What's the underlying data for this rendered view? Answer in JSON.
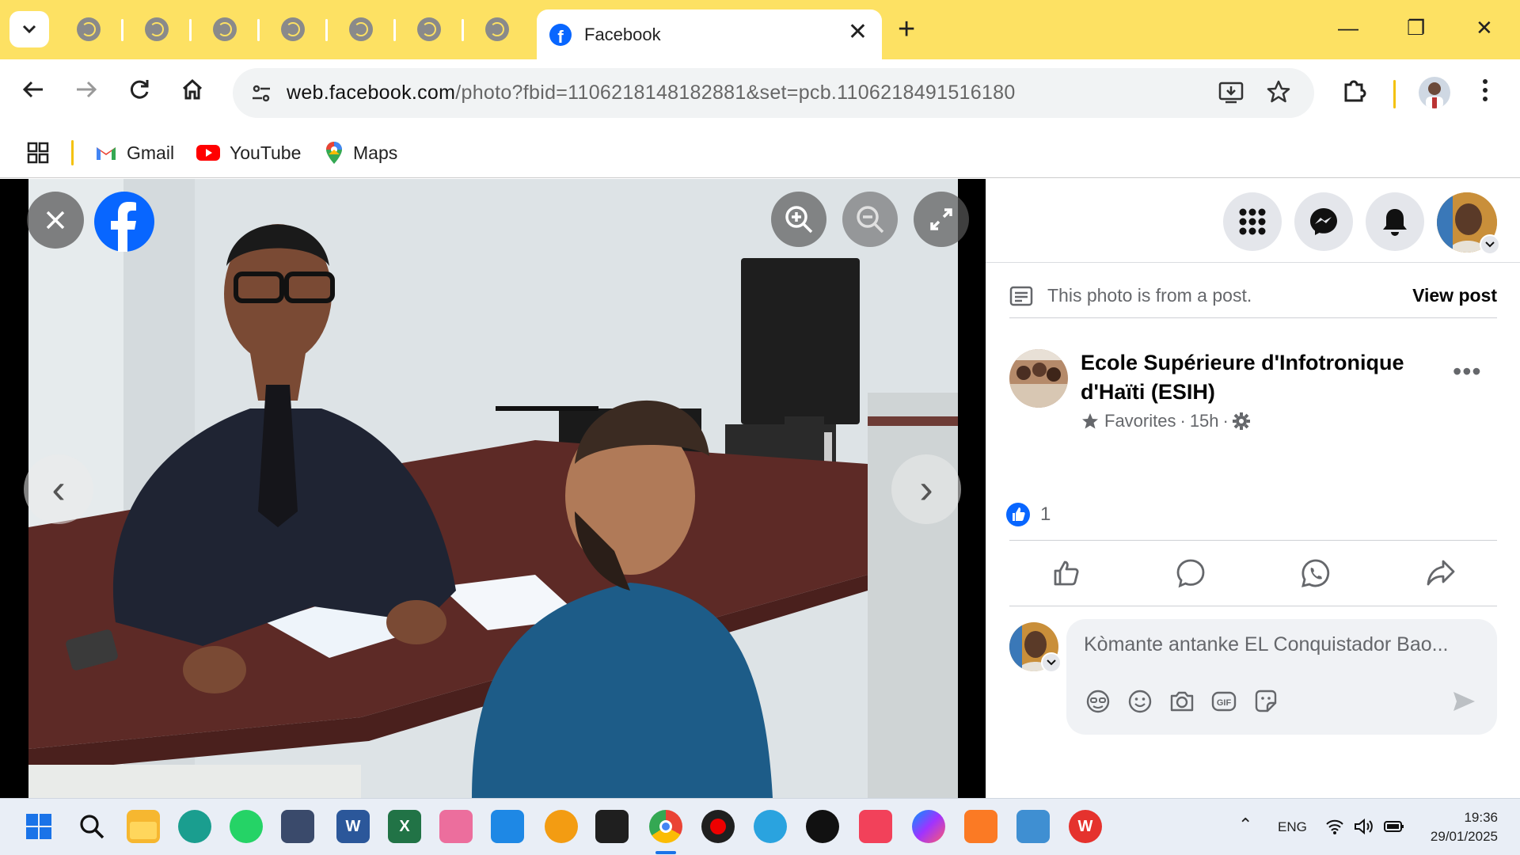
{
  "browser": {
    "active_tab": {
      "title": "Facebook"
    },
    "new_tab_symbol": "+",
    "close_symbol": "✕",
    "window_controls": {
      "minimize": "—",
      "restore": "❐",
      "close": "✕"
    },
    "url": {
      "host": "web.facebook.com",
      "path": "/photo?fbid=1106218148182881&set=pcb.1106218491516180"
    },
    "bookmarks": [
      {
        "label": "Gmail",
        "icon": "gmail-icon"
      },
      {
        "label": "YouTube",
        "icon": "youtube-icon"
      },
      {
        "label": "Maps",
        "icon": "maps-icon"
      }
    ]
  },
  "viewer": {
    "prev_symbol": "‹",
    "next_symbol": "›"
  },
  "post": {
    "photo_note": "This photo is from a post.",
    "view_post": "View post",
    "page_name": "Ecole Supérieure d'Infotronique d'Haïti (ESIH)",
    "meta_favorites": "Favorites",
    "meta_time": "15h",
    "more": "•••",
    "reaction_count": "1",
    "comment_placeholder": "Kòmante antanke EL Conquistador Bao..."
  },
  "taskbar": {
    "language": "ENG",
    "time": "19:36",
    "date": "29/01/2025",
    "tray_chevron": "⌃"
  },
  "colors": {
    "tab_strip": "#fde163",
    "facebook_blue": "#0866ff",
    "panel_grey": "#e4e6eb"
  }
}
